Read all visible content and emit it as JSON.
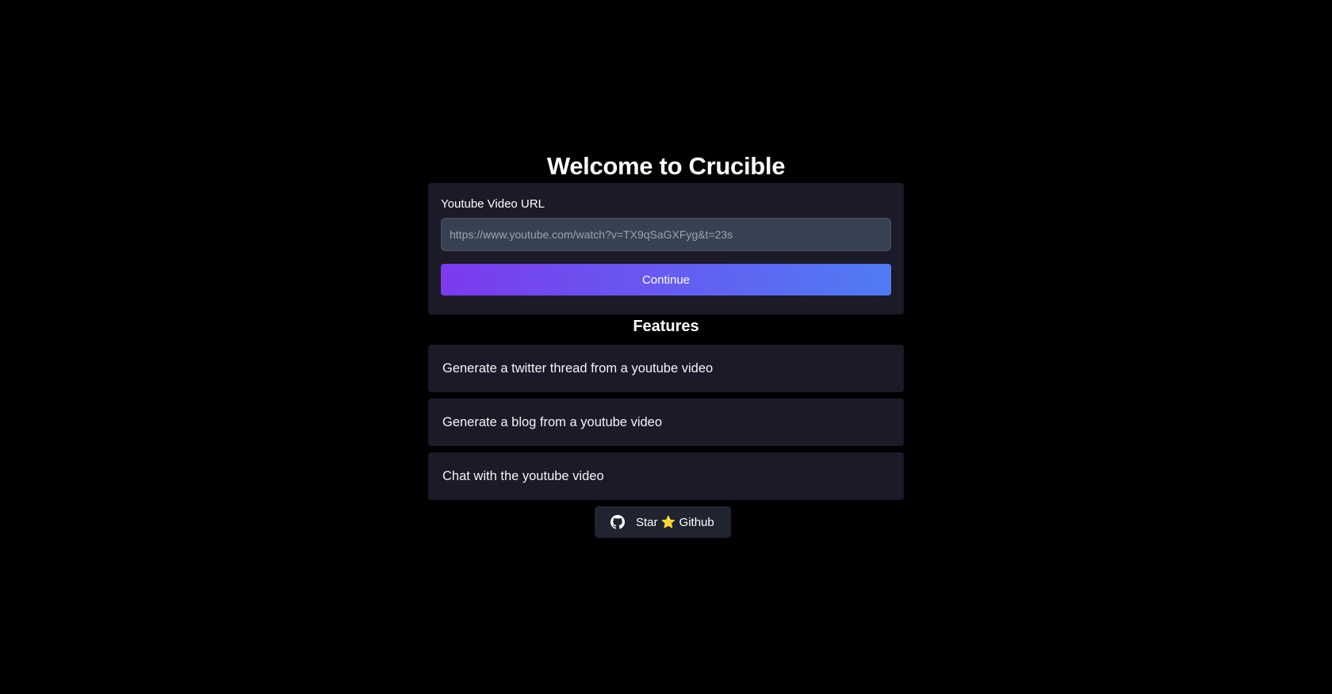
{
  "header": {
    "title": "Welcome to Crucible"
  },
  "form": {
    "label": "Youtube Video URL",
    "placeholder": "https://www.youtube.com/watch?v=TX9qSaGXFyg&t=23s",
    "value": "",
    "button_label": "Continue"
  },
  "features": {
    "title": "Features",
    "items": [
      {
        "label": "Generate a twitter thread from a youtube video"
      },
      {
        "label": "Generate a blog from a youtube video"
      },
      {
        "label": "Chat with the youtube video"
      }
    ]
  },
  "github": {
    "label": "Star ⭐ Github",
    "icon": "github-icon"
  },
  "colors": {
    "background": "#000000",
    "card": "#1b1a28",
    "input": "#374151",
    "gradient_start": "#7c3aed",
    "gradient_end": "#4f7cf5",
    "github_button": "#1f2430"
  }
}
